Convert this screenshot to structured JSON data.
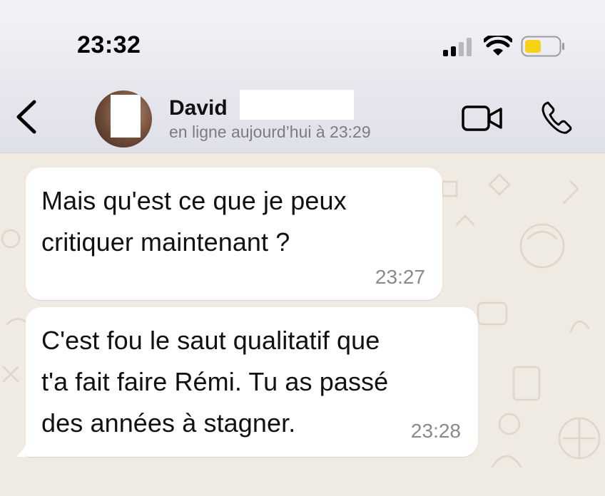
{
  "status_bar": {
    "time": "23:32"
  },
  "header": {
    "contact_name": "David",
    "contact_status": "en ligne aujourd’hui à 23:29"
  },
  "icons": {
    "back": "chevron-left-icon",
    "video": "video-camera-icon",
    "call": "phone-icon",
    "signal": "cellular-signal-icon",
    "wifi": "wifi-icon",
    "battery": "battery-icon"
  },
  "colors": {
    "battery_fill": "#f7d117",
    "chat_background": "#efeae2",
    "bubble": "#ffffff"
  },
  "messages": [
    {
      "text": "Mais qu'est ce que je peux\ncritiquer maintenant ?",
      "time": "23:27"
    },
    {
      "text": "C'est fou le saut qualitatif que\nt'a fait faire Rémi. Tu as passé\ndes années à stagner.",
      "time": "23:28"
    }
  ]
}
